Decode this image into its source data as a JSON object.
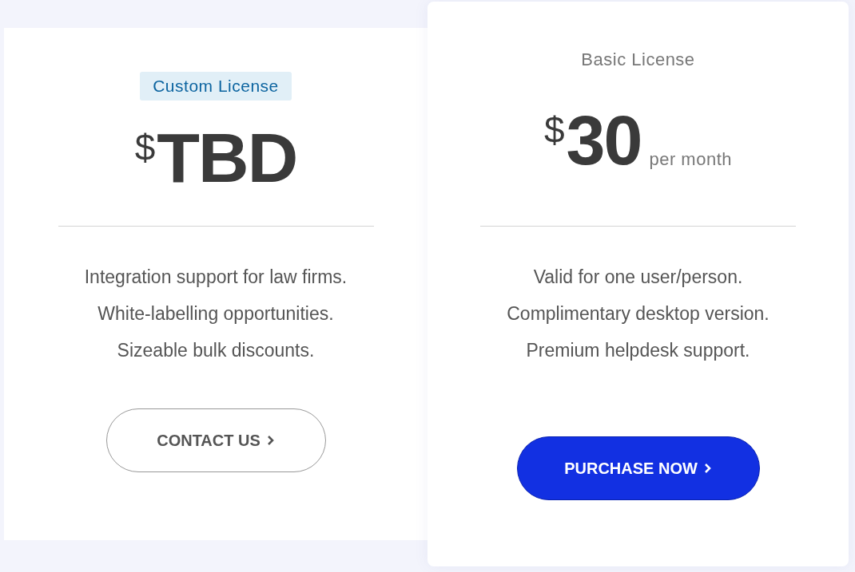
{
  "plans": [
    {
      "featured": false,
      "label": {
        "text": "Custom License",
        "kind": "badge"
      },
      "currency": "$",
      "amount": "TBD",
      "features": [
        "Integration support for law firms.",
        "White-labelling opportunities.",
        "Sizeable bulk discounts."
      ],
      "button": {
        "text": "CONTACT US",
        "kind": "outline"
      }
    },
    {
      "featured": true,
      "label": {
        "text": "Basic License",
        "kind": "plain"
      },
      "currency": "$",
      "amount": "30",
      "period": "per month",
      "features": [
        "Valid for one user/person.",
        "Complimentary desktop version.",
        "Premium helpdesk support."
      ],
      "button": {
        "text": "PURCHASE NOW",
        "kind": "primary"
      }
    }
  ]
}
